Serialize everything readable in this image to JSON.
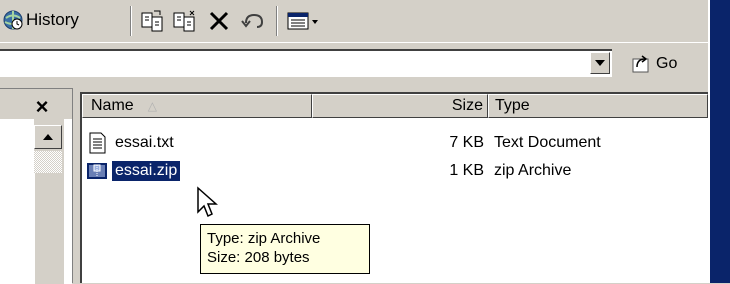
{
  "toolbar": {
    "history_label": "History",
    "icons": [
      "history-icon",
      "move-to-icon",
      "copy-to-icon",
      "delete-icon",
      "undo-icon",
      "views-icon"
    ]
  },
  "address_bar": {
    "value": "",
    "go_label": "Go"
  },
  "folder_pane": {
    "close_label": "×"
  },
  "file_list": {
    "columns": [
      "Name",
      "Size",
      "Type"
    ],
    "sort_column": "Name",
    "rows": [
      {
        "name": "essai.txt",
        "size": "7 KB",
        "type": "Text Document",
        "icon": "text-file-icon",
        "selected": false
      },
      {
        "name": "essai.zip",
        "size": "1 KB",
        "type": "zip Archive",
        "icon": "zip-file-icon",
        "selected": true
      }
    ]
  },
  "tooltip": {
    "line1": "Type: zip Archive",
    "line2": "Size: 208 bytes"
  },
  "colors": {
    "selection": "#0a246a",
    "tooltip_bg": "#ffffe1",
    "chrome": "#d4d0c8"
  }
}
